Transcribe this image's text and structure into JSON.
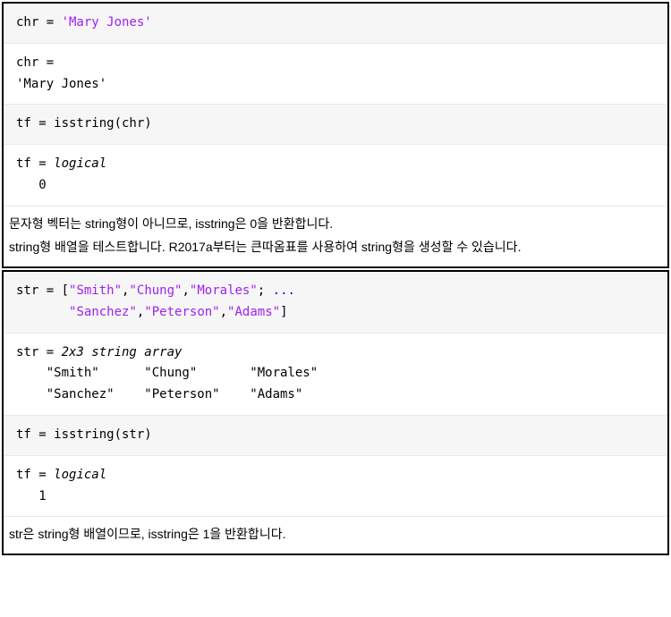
{
  "ex1": {
    "code1_prefix": "chr = ",
    "code1_value": "'Mary Jones'",
    "out1_line1": "chr =",
    "out1_line2": "'Mary Jones'",
    "code2": "tf = isstring(chr)",
    "out2_line1": "tf = ",
    "out2_type": "logical",
    "out2_val": "   0",
    "desc1": "문자형 벡터는 string형이 아니므로, isstring은 0을 반환합니다.",
    "desc2": "string형 배열을 테스트합니다. R2017a부터는 큰따옴표를 사용하여 string형을 생성할 수 있습니다."
  },
  "ex2": {
    "code_prefix": "str = [",
    "s11": "\"Smith\"",
    "s12": "\"Chung\"",
    "s13": "\"Morales\"",
    "s21": "\"Sanchez\"",
    "s22": "\"Peterson\"",
    "s23": "\"Adams\"",
    "cont": "...",
    "out1_line1": "str = ",
    "out1_type": "2x3 string array",
    "out1_row1": "    \"Smith\"      \"Chung\"       \"Morales\"",
    "out1_row2": "    \"Sanchez\"    \"Peterson\"    \"Adams\"",
    "code2": "tf = isstring(str)",
    "out2_line1": "tf = ",
    "out2_type": "logical",
    "out2_val": "   1",
    "desc": "str은 string형 배열이므로, isstring은 1을 반환합니다."
  }
}
